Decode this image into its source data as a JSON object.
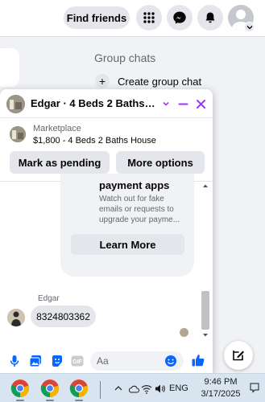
{
  "topbar": {
    "find_friends_label": "Find friends",
    "icons": [
      "grid-menu-icon",
      "messenger-icon",
      "bell-icon",
      "profile-avatar"
    ]
  },
  "background": {
    "group_chats_label": "Group chats",
    "create_group_label": "Create group chat"
  },
  "chat": {
    "title": "Edgar · 4 Beds 2 Baths Hou...",
    "marketplace": {
      "label": "Marketplace",
      "listing": "$1,800 - 4 Beds 2 Baths House",
      "mark_pending_label": "Mark as pending",
      "more_options_label": "More options"
    },
    "safety_card": {
      "heading": "payment apps",
      "body": "Watch out for fake emails or requests to upgrade your payme...",
      "learn_more_label": "Learn More"
    },
    "sender_name": "Edgar",
    "last_message": "8324803362",
    "composer_placeholder": "Aa"
  },
  "taskbar": {
    "language": "ENG",
    "time": "9:46 PM",
    "date": "3/17/2025"
  },
  "colors": {
    "accent": "#0866ff",
    "messenger_purple": "#a033ff",
    "chat_bg": "#ffffff",
    "bubble_gray": "#e4e6eb"
  }
}
